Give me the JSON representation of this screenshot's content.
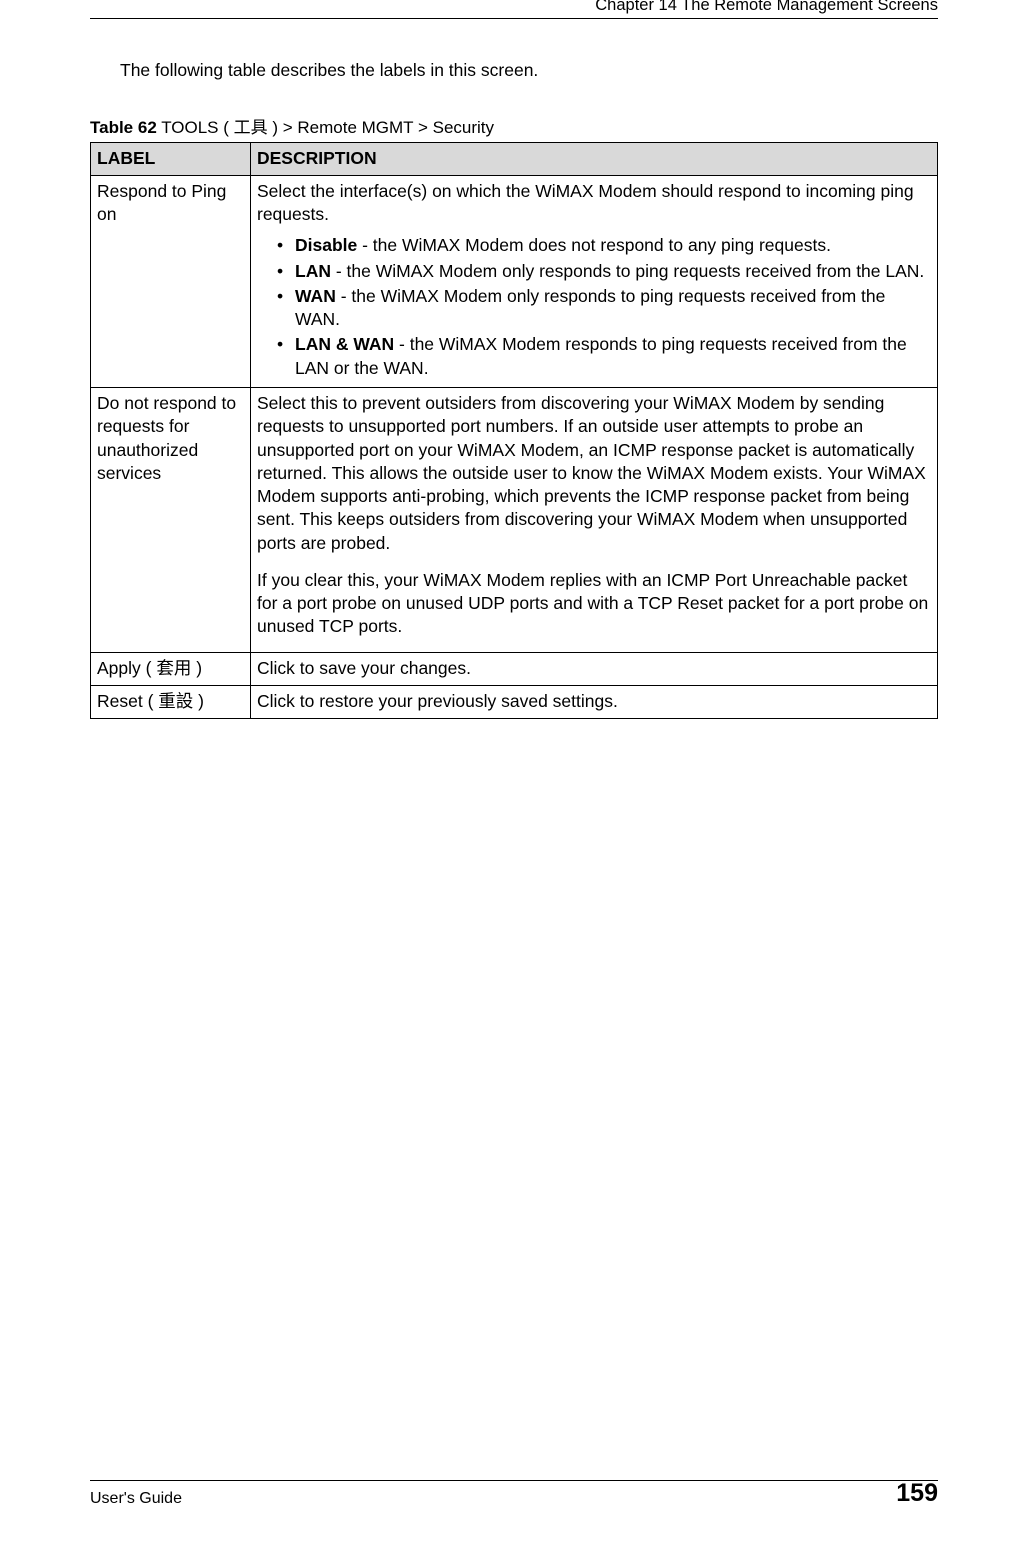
{
  "header": {
    "chapter": "Chapter 14 The Remote Management Screens"
  },
  "intro": "The following table describes the labels in this screen.",
  "table_caption": {
    "bold": "Table 62",
    "rest": "   TOOLS ( 工具 ) > Remote MGMT > Security"
  },
  "table_headers": {
    "label": "LABEL",
    "description": "DESCRIPTION"
  },
  "rows": {
    "r1": {
      "label": "Respond to Ping on",
      "intro": "Select the interface(s) on which the WiMAX Modem should respond to incoming ping requests.",
      "opts": {
        "o1b": "Disable",
        "o1t": " - the WiMAX Modem does not respond to any ping requests.",
        "o2b": "LAN",
        "o2t": " - the WiMAX Modem only responds to ping requests received from the LAN.",
        "o3b": "WAN",
        "o3t": " - the WiMAX Modem only responds to ping requests received from the WAN.",
        "o4b": "LAN & WAN",
        "o4t": " - the WiMAX Modem responds to ping requests received from the LAN or the WAN."
      }
    },
    "r2": {
      "label": "Do not respond to requests for unauthorized services",
      "p1": "Select this to prevent outsiders from discovering your WiMAX Modem by sending requests to unsupported port numbers. If an outside user attempts to probe an unsupported port on your WiMAX Modem, an ICMP response packet is automatically returned. This allows the outside user to know the WiMAX Modem exists. Your WiMAX Modem supports anti-probing, which prevents the ICMP response packet from being sent. This keeps outsiders from discovering your WiMAX Modem when unsupported ports are probed.",
      "p2": "If you clear this, your WiMAX Modem replies with an ICMP Port Unreachable packet for a port probe on unused UDP ports and with a TCP Reset packet for a port probe on unused TCP ports."
    },
    "r3": {
      "label": "Apply ( 套用 )",
      "desc": "Click to save your changes."
    },
    "r4": {
      "label": "Reset ( 重設 )",
      "desc": "Click to restore your previously saved settings."
    }
  },
  "footer": {
    "left": "User's Guide",
    "right": "159"
  }
}
